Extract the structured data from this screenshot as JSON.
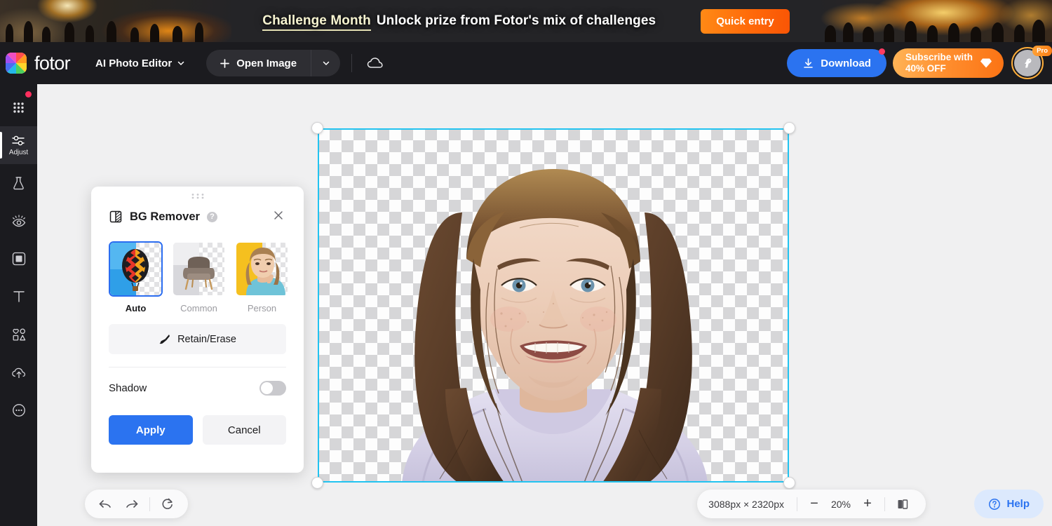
{
  "promo": {
    "highlight": "Challenge Month",
    "message": "Unlock prize from Fotor's mix of challenges",
    "cta_label": "Quick entry"
  },
  "header": {
    "brand": "fotor",
    "workspace": "AI Photo Editor",
    "open_image_label": "Open Image",
    "download_label": "Download",
    "subscribe_label": "Subscribe with\n40% OFF",
    "pro_badge": "Pro",
    "icons": {
      "plus": "plus-icon",
      "chevron": "chevron-down-icon",
      "cloud": "cloud-icon",
      "download": "download-icon",
      "diamond": "diamond-icon",
      "avatar": "bird-avatar-icon"
    }
  },
  "sidebar": {
    "items": [
      {
        "name": "apps",
        "icon": "grid-dots-icon",
        "label": "",
        "active": false,
        "badge": true
      },
      {
        "name": "adjust",
        "icon": "sliders-icon",
        "label": "Adjust",
        "active": true,
        "badge": false
      },
      {
        "name": "ai-tools",
        "icon": "flask-icon",
        "label": "",
        "active": false,
        "badge": false
      },
      {
        "name": "retouch",
        "icon": "eye-icon",
        "label": "",
        "active": false,
        "badge": false
      },
      {
        "name": "effects",
        "icon": "frame-square-icon",
        "label": "",
        "active": false,
        "badge": false
      },
      {
        "name": "text",
        "icon": "text-t-icon",
        "label": "",
        "active": false,
        "badge": false
      },
      {
        "name": "elements",
        "icon": "shapes-icon",
        "label": "",
        "active": false,
        "badge": false
      },
      {
        "name": "upload",
        "icon": "cloud-upload-icon",
        "label": "",
        "active": false,
        "badge": false
      },
      {
        "name": "more",
        "icon": "more-circle-icon",
        "label": "",
        "active": false,
        "badge": false
      }
    ]
  },
  "panel": {
    "title": "BG Remover",
    "help_icon": "question-mark-icon",
    "close_icon": "close-icon",
    "drag_icon": "drag-handle-icon",
    "tool_icon": "bg-remover-icon",
    "modes": [
      {
        "label": "Auto",
        "selected": true,
        "thumb": "hot-air-balloon"
      },
      {
        "label": "Common",
        "selected": false,
        "thumb": "armchair"
      },
      {
        "label": "Person",
        "selected": false,
        "thumb": "woman-portrait"
      }
    ],
    "retain_erase_label": "Retain/Erase",
    "retain_erase_icon": "brush-icon",
    "shadow_label": "Shadow",
    "shadow_enabled": false,
    "apply_label": "Apply",
    "cancel_label": "Cancel"
  },
  "bottom_bar": {
    "undo_icon": "undo-arrow-icon",
    "redo_icon": "redo-arrow-icon",
    "reset_icon": "reset-circular-arrow-icon",
    "image_dimensions": "3088px × 2320px",
    "zoom_out_label": "−",
    "zoom_level": "20%",
    "zoom_in_label": "+",
    "compare_icon": "compare-split-icon",
    "help_label": "Help",
    "help_icon": "question-circle-icon"
  },
  "colors": {
    "accent_blue": "#2b73f0",
    "selection_cyan": "#22c3f0",
    "promo_orange": "#ff6a0a",
    "badge_red": "#ff3b62",
    "pro_gold": "#ffae3a"
  }
}
